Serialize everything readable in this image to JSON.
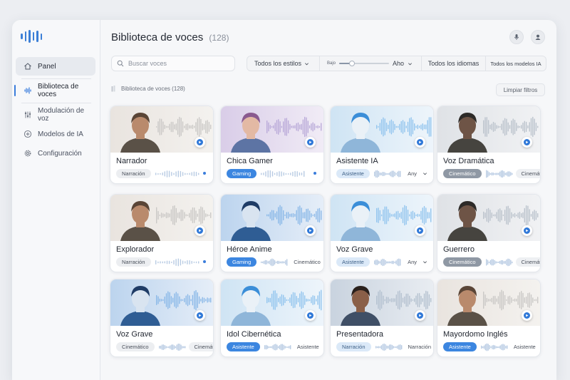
{
  "app": {
    "title": "Biblioteca de voces",
    "count": "(128)"
  },
  "sidebar": {
    "items": [
      {
        "label": "Panel",
        "icon": "home-icon"
      },
      {
        "label": "Biblioteca de voces",
        "icon": "waveform-icon"
      },
      {
        "label": "Modulación de voz",
        "icon": "sliders-icon"
      },
      {
        "label": "Modelos de IA",
        "icon": "ai-model-icon"
      },
      {
        "label": "Configuración",
        "icon": "gear-icon"
      }
    ]
  },
  "search": {
    "placeholder": "Buscar voces"
  },
  "filters": {
    "styles": "Todos los estilos",
    "pitch_low": "Bajo",
    "pitch_high": "Aho",
    "pitch_level": 0.25,
    "languages": "Todos los idiomas",
    "models": "Todos los modelos IA"
  },
  "subbar": {
    "label": "Biblioteca de voces (128)"
  },
  "clear_filters": "Limpiar filtros",
  "colors": {
    "accent": "#3c86e0",
    "card_bg": "#ffffff"
  },
  "voices": [
    {
      "name": "Narrador",
      "tag": "Narración",
      "tag_style": "grey",
      "right": "",
      "right_kind": "dot",
      "art": "warm"
    },
    {
      "name": "Chica Gamer",
      "tag": "Gaming",
      "tag_style": "blue",
      "right": "",
      "right_kind": "dot",
      "art": "purple"
    },
    {
      "name": "Asistente IA",
      "tag": "Asistente",
      "tag_style": "lightblue",
      "right": "Any",
      "right_kind": "select",
      "art": "cyan"
    },
    {
      "name": "Voz Dramática",
      "tag": "Cinemático",
      "tag_style": "dark",
      "right": "Cinemático",
      "right_kind": "tag",
      "art": "mono"
    },
    {
      "name": "Explorador",
      "tag": "Narración",
      "tag_style": "grey",
      "right": "",
      "right_kind": "dot",
      "art": "warm"
    },
    {
      "name": "Héroe Anime",
      "tag": "Gaming",
      "tag_style": "blue",
      "right": "Cinemático",
      "right_kind": "text",
      "art": "blue"
    },
    {
      "name": "Voz Grave",
      "tag": "Asistente",
      "tag_style": "lightblue",
      "right": "Any",
      "right_kind": "select",
      "art": "cyan"
    },
    {
      "name": "Guerrero",
      "tag": "Cinemático",
      "tag_style": "dark",
      "right": "Cinemático",
      "right_kind": "tag",
      "art": "mono"
    },
    {
      "name": "Voz Grave",
      "tag": "Cinemático",
      "tag_style": "grey",
      "right": "Cinemático",
      "right_kind": "tag",
      "art": "blue"
    },
    {
      "name": "Idol Cibernética",
      "tag": "Asistente",
      "tag_style": "blue",
      "right": "Asistente",
      "right_kind": "text",
      "art": "cyan"
    },
    {
      "name": "Presentadora",
      "tag": "Narración",
      "tag_style": "lightblue",
      "right": "Narración",
      "right_kind": "text",
      "art": "studio"
    },
    {
      "name": "Mayordomo Inglés",
      "tag": "Asistente",
      "tag_style": "blue",
      "right": "Asistente",
      "right_kind": "text",
      "art": "warm"
    }
  ]
}
